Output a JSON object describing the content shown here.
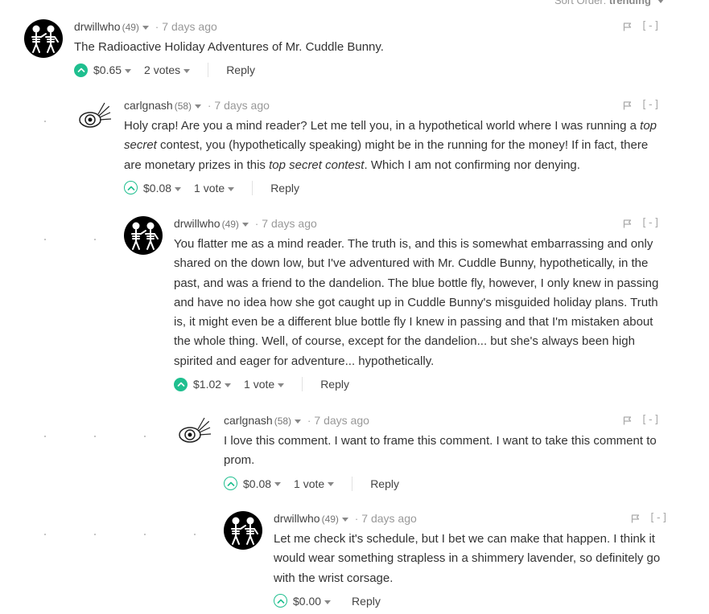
{
  "sort": {
    "label": "Sort Order:",
    "value": "trending"
  },
  "collapse_label": "[-]",
  "separator": "·",
  "reply_label": "Reply",
  "colors": {
    "upvote": "#1fbf8f"
  },
  "comments": [
    {
      "author": "drwillwho",
      "rep": "(49)",
      "age": "7 days ago",
      "avatar_icon": "skeleton-dancers-avatar",
      "segments": [
        {
          "t": "The Radioactive Holiday Adventures of Mr. Cuddle Bunny."
        }
      ],
      "voted": true,
      "payout": "$0.65",
      "votes": "2 votes"
    },
    {
      "author": "carlgnash",
      "rep": "(58)",
      "age": "7 days ago",
      "avatar_icon": "eye-sketch-avatar",
      "segments": [
        {
          "t": "Holy crap! Are you a mind reader? Let me tell you, in a hypothetical world where I was running a "
        },
        {
          "t": "top secret",
          "i": true
        },
        {
          "t": " contest, you (hypothetically speaking) might be in the running for the money! If in fact, there are monetary prizes in this "
        },
        {
          "t": "top secret contest",
          "i": true
        },
        {
          "t": ". Which I am not confirming nor denying."
        }
      ],
      "voted": false,
      "payout": "$0.08",
      "votes": "1 vote"
    },
    {
      "author": "drwillwho",
      "rep": "(49)",
      "age": "7 days ago",
      "avatar_icon": "skeleton-dancers-avatar",
      "segments": [
        {
          "t": "You flatter me as a mind reader. The truth is, and this is somewhat embarrassing and only shared on the down low, but I've adventured with Mr. Cuddle Bunny, hypothetically, in the past, and was a friend to the dandelion. The blue bottle fly, however, I only knew in passing and have no idea how she got caught up in Cuddle Bunny's misguided holiday plans. Truth is, it might even be a different blue bottle fly I knew in passing and that I'm mistaken about the whole thing. Well, of course, except for the dandelion... but she's always been high spirited and eager for adventure... hypothetically."
        }
      ],
      "voted": true,
      "payout": "$1.02",
      "votes": "1 vote"
    },
    {
      "author": "carlgnash",
      "rep": "(58)",
      "age": "7 days ago",
      "avatar_icon": "eye-sketch-avatar",
      "segments": [
        {
          "t": "I love this comment. I want to frame this comment. I want to take this comment to prom."
        }
      ],
      "voted": false,
      "payout": "$0.08",
      "votes": "1 vote"
    },
    {
      "author": "drwillwho",
      "rep": "(49)",
      "age": "7 days ago",
      "avatar_icon": "skeleton-dancers-avatar",
      "segments": [
        {
          "t": "Let me check it's schedule, but I bet we can make that happen. I think it would wear something strapless in a shimmery lavender, so definitely go with the wrist corsage."
        }
      ],
      "voted": false,
      "payout": "$0.00",
      "votes": null
    }
  ]
}
